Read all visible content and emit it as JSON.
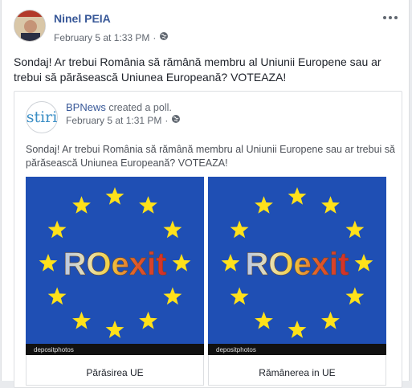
{
  "post": {
    "author": "Ninel PEIA",
    "timestamp": "February 5 at 1:33 PM",
    "privacy_icon": "globe-icon",
    "message": "Sondaj! Ar trebui România să rămână membru al Uniunii Europene sau ar trebui să părăsească Uniunea Europeană? VOTEAZA!"
  },
  "shared": {
    "page_name": "BPNews",
    "action": " created a poll.",
    "avatar_text": "stiri",
    "timestamp": "February 5 at 1:31 PM",
    "privacy_icon": "globe-icon",
    "message": "Sondaj! Ar trebui România să rămână membru al Uniunii Europene sau ar trebui să părăsească Uniunea Europeană? VOTEAZA!"
  },
  "poll": {
    "options": [
      {
        "image_text": "ROexit",
        "label": "Părăsirea UE"
      },
      {
        "image_text": "ROexit",
        "label": "Rămânerea in UE"
      }
    ],
    "watermark": "depositphotos"
  },
  "colors": {
    "link": "#385898",
    "eu_blue": "#1f4fb4",
    "eu_star": "#ffe11a"
  }
}
